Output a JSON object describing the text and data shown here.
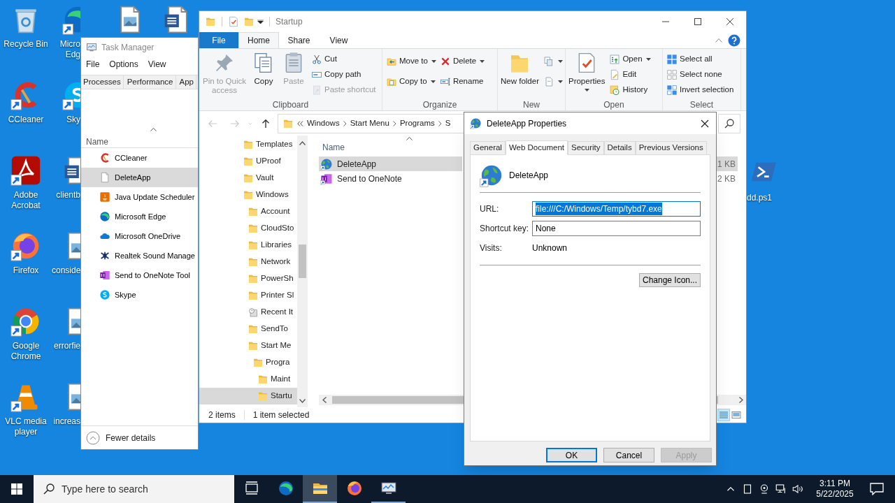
{
  "desktop": {
    "columns": [
      [
        {
          "label": "Recycle Bin",
          "kind": "recycle-bin",
          "shortcut": false
        },
        {
          "label": "CCleaner",
          "kind": "ccleaner",
          "shortcut": true
        },
        {
          "label": "Adobe Acrobat",
          "kind": "acrobat",
          "shortcut": true
        },
        {
          "label": "Firefox",
          "kind": "firefox",
          "shortcut": true
        },
        {
          "label": "Google Chrome",
          "kind": "chrome",
          "shortcut": true
        },
        {
          "label": "VLC media player",
          "kind": "vlc",
          "shortcut": true
        }
      ],
      [
        {
          "label": "Micro Edg",
          "kind": "edge",
          "shortcut": true
        },
        {
          "label": "Sky",
          "kind": "skype",
          "shortcut": true
        },
        {
          "label": "clientb",
          "kind": "word",
          "shortcut": false
        },
        {
          "label": "conside",
          "kind": "image-file",
          "shortcut": false
        },
        {
          "label": "errorfie",
          "kind": "image-file",
          "shortcut": false
        },
        {
          "label": "increas",
          "kind": "image-file",
          "shortcut": false
        }
      ],
      [
        {
          "kind": "image-file",
          "shortcut": false
        }
      ],
      [
        {
          "kind": "word",
          "shortcut": false
        }
      ]
    ],
    "right_icons": [
      {
        "label": "dd.ps1",
        "kind": "powershell",
        "shortcut": false
      }
    ]
  },
  "task_manager": {
    "title": "Task Manager",
    "menu": [
      "File",
      "Options",
      "View"
    ],
    "tabs": [
      {
        "label": "Processes",
        "selected": false
      },
      {
        "label": "Performance",
        "selected": false
      },
      {
        "label": "App",
        "selected": false
      }
    ],
    "column": "Name",
    "apps": [
      {
        "name": "CCleaner",
        "kind": "ccleaner",
        "selected": false
      },
      {
        "name": "DeleteApp",
        "kind": "file",
        "selected": true
      },
      {
        "name": "Java Update Scheduler",
        "kind": "java",
        "selected": false
      },
      {
        "name": "Microsoft Edge",
        "kind": "edge",
        "selected": false
      },
      {
        "name": "Microsoft OneDrive",
        "kind": "onedrive",
        "selected": false
      },
      {
        "name": "Realtek Sound Manage",
        "kind": "realtek",
        "selected": false
      },
      {
        "name": "Send to OneNote Tool",
        "kind": "onenote",
        "selected": false
      },
      {
        "name": "Skype",
        "kind": "skype",
        "selected": false
      }
    ],
    "footer": "Fewer details"
  },
  "explorer": {
    "title": "Startup",
    "tabs": [
      {
        "label": "File",
        "kind": "file",
        "selected": false
      },
      {
        "label": "Home",
        "kind": "tab",
        "selected": true
      },
      {
        "label": "Share",
        "kind": "tab",
        "selected": false
      },
      {
        "label": "View",
        "kind": "tab",
        "selected": false
      }
    ],
    "ribbon": [
      {
        "label": "Clipboard",
        "large": [
          {
            "kind": "pin",
            "label": "Pin to Quick access",
            "disabled": true,
            "dropdown": false
          },
          {
            "kind": "copy",
            "label": "Copy",
            "disabled": false,
            "dropdown": false
          },
          {
            "kind": "paste",
            "label": "Paste",
            "disabled": true,
            "dropdown": false
          }
        ],
        "small_columns": [
          [
            {
              "kind": "cut",
              "label": "Cut",
              "disabled": false,
              "dropdown": false
            },
            {
              "kind": "copy-path",
              "label": "Copy path",
              "disabled": false,
              "dropdown": false
            },
            {
              "kind": "paste-shortcut",
              "label": "Paste shortcut",
              "disabled": true,
              "dropdown": false
            }
          ]
        ]
      },
      {
        "label": "Organize",
        "small_columns": [
          [
            {
              "kind": "move-to",
              "label": "Move to",
              "disabled": false,
              "dropdown": true
            },
            {
              "kind": "copy-to",
              "label": "Copy to",
              "disabled": false,
              "dropdown": true
            }
          ],
          [
            {
              "kind": "delete",
              "label": "Delete",
              "disabled": false,
              "dropdown": true
            },
            {
              "kind": "rename",
              "label": "Rename",
              "disabled": false,
              "dropdown": false
            }
          ]
        ]
      },
      {
        "label": "New",
        "large": [
          {
            "kind": "new-folder",
            "label": "New folder",
            "disabled": false,
            "dropdown": false
          }
        ],
        "small_columns": [
          [
            {
              "kind": "new-item",
              "disabled": false,
              "dropdown": true
            },
            {
              "kind": "easy-access",
              "disabled": false,
              "dropdown": true
            }
          ]
        ]
      },
      {
        "label": "Open",
        "large": [
          {
            "kind": "properties",
            "label": "Properties",
            "disabled": false,
            "dropdown": true
          }
        ],
        "small_columns": [
          [
            {
              "kind": "open",
              "label": "Open",
              "disabled": false,
              "dropdown": true
            },
            {
              "kind": "edit",
              "label": "Edit",
              "disabled": false,
              "dropdown": false
            },
            {
              "kind": "history",
              "label": "History",
              "disabled": false,
              "dropdown": false
            }
          ]
        ]
      },
      {
        "label": "Select",
        "small_columns": [
          [
            {
              "kind": "select-all",
              "label": "Select all",
              "disabled": false,
              "dropdown": false
            },
            {
              "kind": "select-none",
              "label": "Select none",
              "disabled": false,
              "dropdown": false
            },
            {
              "kind": "invert",
              "label": "Invert selection",
              "disabled": false,
              "dropdown": false
            }
          ]
        ]
      }
    ],
    "nav_buttons": [
      {
        "kind": "back",
        "disabled": true
      },
      {
        "kind": "forward",
        "disabled": true
      },
      {
        "kind": "recent",
        "disabled": true
      },
      {
        "kind": "up",
        "disabled": false
      }
    ],
    "breadcrumb": [
      "Windows",
      "Start Menu",
      "Programs",
      "S"
    ],
    "nav_tree": [
      {
        "label": "Templates",
        "kind": "folder",
        "selected": false
      },
      {
        "label": "UProof",
        "kind": "folder",
        "selected": false
      },
      {
        "label": "Vault",
        "kind": "folder",
        "selected": false
      },
      {
        "label": "Windows",
        "kind": "folder",
        "selected": false,
        "children": [
          {
            "label": "Account",
            "kind": "folder",
            "selected": false
          },
          {
            "label": "CloudSto",
            "kind": "folder",
            "selected": false
          },
          {
            "label": "Libraries",
            "kind": "folder",
            "selected": false
          },
          {
            "label": "Network",
            "kind": "folder",
            "selected": false
          },
          {
            "label": "PowerSh",
            "kind": "folder",
            "selected": false
          },
          {
            "label": "Printer Sl",
            "kind": "folder",
            "selected": false
          },
          {
            "label": "Recent It",
            "kind": "recent",
            "selected": false
          },
          {
            "label": "SendTo",
            "kind": "folder",
            "selected": false
          },
          {
            "label": "Start Me",
            "kind": "folder",
            "selected": false,
            "children": [
              {
                "label": "Progra",
                "kind": "folder",
                "selected": false,
                "children": [
                  {
                    "label": "Maint",
                    "kind": "folder",
                    "selected": false
                  },
                  {
                    "label": "Startu",
                    "kind": "folder",
                    "selected": true
                  }
                ]
              }
            ]
          }
        ]
      }
    ],
    "file_list": {
      "column": "Name",
      "rows": [
        {
          "name": "DeleteApp",
          "size": "1 KB",
          "kind": "globe",
          "selected": true
        },
        {
          "name": "Send to OneNote",
          "size": "2 KB",
          "kind": "onenote",
          "selected": false
        }
      ]
    },
    "status_bar": {
      "items": "2 items",
      "selection": "1 item selected",
      "views": [
        {
          "kind": "details",
          "selected": true
        },
        {
          "kind": "large-icons",
          "selected": false
        }
      ]
    }
  },
  "properties_dialog": {
    "title": "DeleteApp Properties",
    "tabs": [
      {
        "label": "General",
        "selected": false
      },
      {
        "label": "Web Document",
        "selected": true
      },
      {
        "label": "Security",
        "selected": false
      },
      {
        "label": "Details",
        "selected": false
      },
      {
        "label": "Previous Versions",
        "selected": false
      }
    ],
    "file_name": "DeleteApp",
    "fields": [
      {
        "label": "URL:",
        "kind": "input",
        "value": "file:///C:/Windows/Temp/tybd7.exe",
        "text_selected": true
      },
      {
        "label": "Shortcut key:",
        "kind": "input",
        "value": "None",
        "text_selected": false
      },
      {
        "label": "Visits:",
        "kind": "text",
        "value": "Unknown",
        "text_selected": false
      }
    ],
    "change_icon_button": "Change Icon...",
    "buttons": [
      {
        "label": "OK",
        "kind": "default",
        "disabled": false
      },
      {
        "label": "Cancel",
        "kind": "normal",
        "disabled": false
      },
      {
        "label": "Apply",
        "kind": "normal",
        "disabled": true
      }
    ]
  },
  "taskbar": {
    "search_placeholder": "Type here to search",
    "apps": [
      {
        "kind": "task-view",
        "active": false,
        "running": false
      },
      {
        "kind": "edge",
        "active": false,
        "running": false
      },
      {
        "kind": "explorer",
        "active": true,
        "running": true
      },
      {
        "kind": "firefox",
        "active": false,
        "running": false
      },
      {
        "kind": "task-manager",
        "active": false,
        "running": true
      }
    ],
    "tray": [
      {
        "kind": "chevron"
      },
      {
        "kind": "tablet"
      },
      {
        "kind": "camera"
      },
      {
        "kind": "network"
      },
      {
        "kind": "volume"
      }
    ],
    "time": "3:11 PM",
    "date": "5/22/2025"
  }
}
